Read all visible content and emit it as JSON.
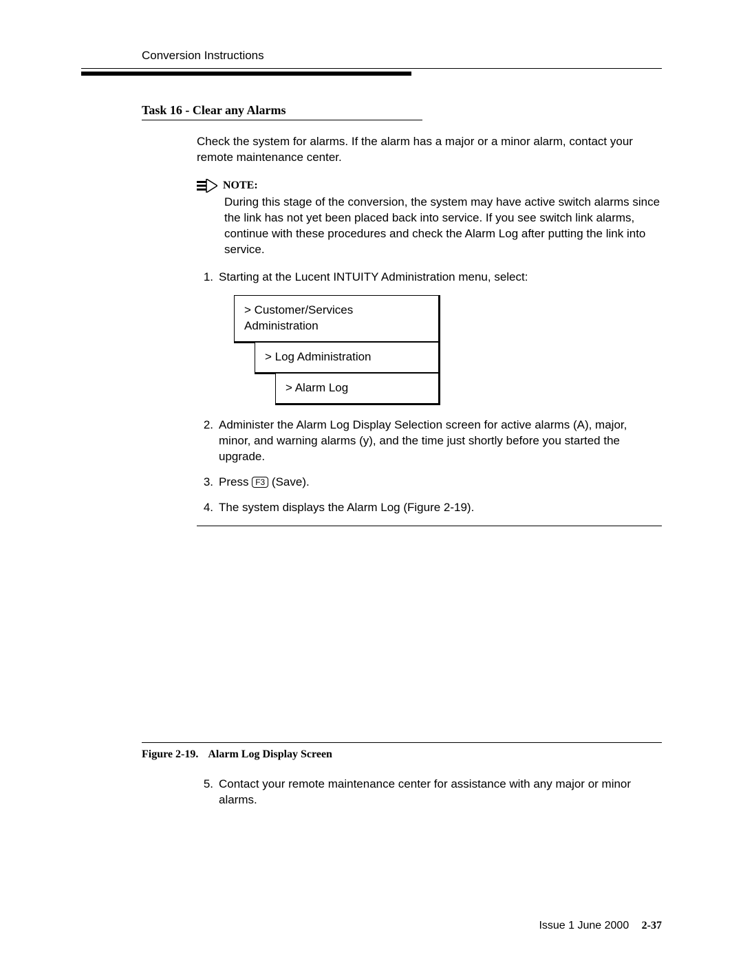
{
  "header": {
    "label": "Conversion Instructions"
  },
  "task_heading": "Task 16 - Clear any Alarms",
  "intro": "Check the system for alarms. If the alarm has a major or a minor alarm, contact your remote maintenance center.",
  "note": {
    "label": "NOTE:",
    "body": "During this stage of the conversion, the system may have active switch alarms since the link has not yet been placed back into service. If you see switch link alarms, continue with these procedures and check the Alarm Log after putting the link into service."
  },
  "steps": {
    "s1": {
      "num": "1.",
      "text": "Starting at the Lucent INTUITY Administration menu, select:"
    },
    "s2": {
      "num": "2.",
      "text": "Administer the Alarm Log Display Selection screen for active alarms (A), major, minor, and warning alarms (y), and the time just shortly before you started the upgrade."
    },
    "s3": {
      "num": "3.",
      "text_a": "Press ",
      "key": "F3",
      "text_b": " (Save)."
    },
    "s4": {
      "num": "4.",
      "text": "The system displays the Alarm Log (Figure 2-19)."
    },
    "s5": {
      "num": "5.",
      "text": "Contact your remote maintenance center for assistance with any major or minor alarms."
    }
  },
  "menu": {
    "l1": "> Customer/Services Administration",
    "l2": "> Log Administration",
    "l3": "> Alarm Log"
  },
  "figure": {
    "label": "Figure 2-19.",
    "title": "Alarm Log Display Screen"
  },
  "footer": {
    "issue": "Issue 1   June 2000",
    "page": "2-37"
  }
}
